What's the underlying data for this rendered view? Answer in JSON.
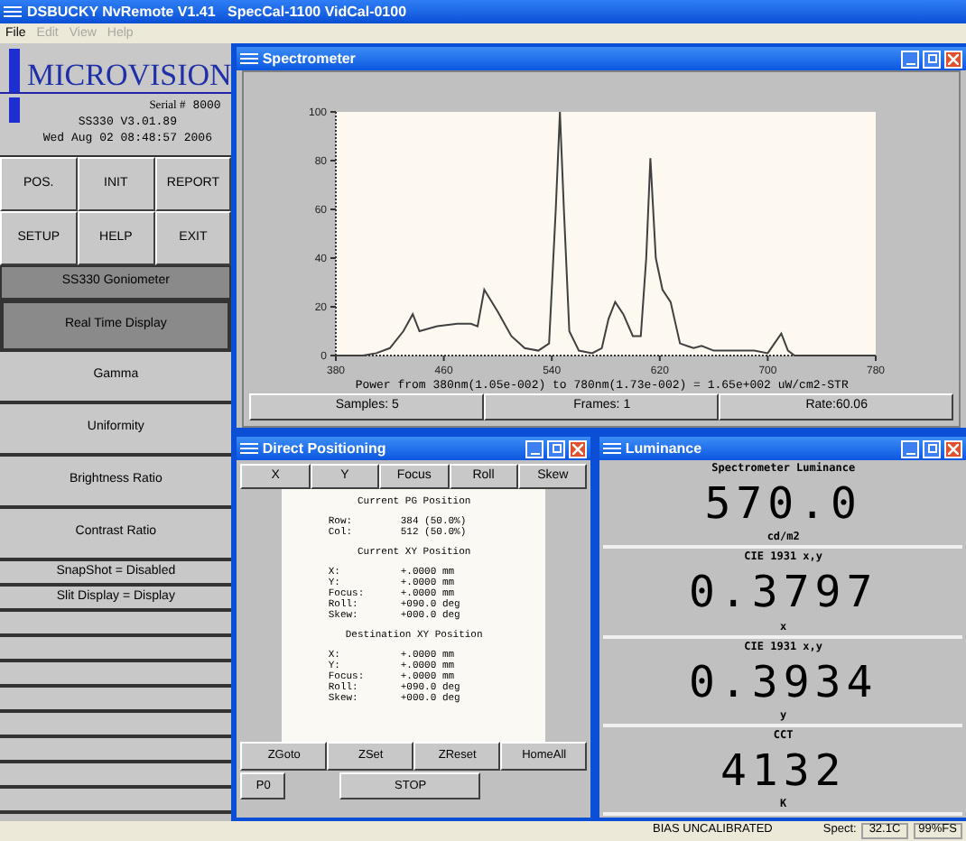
{
  "window": {
    "title": "DSBUCKY NvRemote V1.41   SpecCal-1100 VidCal-0100"
  },
  "menu": [
    {
      "label": "File",
      "disabled": false
    },
    {
      "label": "Edit",
      "disabled": true
    },
    {
      "label": "View",
      "disabled": true
    },
    {
      "label": "Help",
      "disabled": true
    }
  ],
  "sidebar": {
    "logo": "MICROVISION",
    "serial_label": "Serial #",
    "serial": "8000",
    "version": "SS330 V3.01.89",
    "datetime": "Wed Aug 02 08:48:57 2006",
    "buttons": [
      "POS.",
      "INIT",
      "REPORT",
      "SETUP",
      "HELP",
      "EXIT"
    ],
    "header": "SS330 Goniometer",
    "items": [
      {
        "label": "Real Time Display",
        "kind": "mode",
        "selected": true
      },
      {
        "label": "Gamma",
        "kind": "mode",
        "selected": false
      },
      {
        "label": "Uniformity",
        "kind": "mode",
        "selected": false
      },
      {
        "label": "Brightness Ratio",
        "kind": "mode",
        "selected": false
      },
      {
        "label": "Contrast Ratio",
        "kind": "mode",
        "selected": false
      },
      {
        "label": "SnapShot = Disabled",
        "kind": "setting",
        "selected": false
      },
      {
        "label": "Slit Display = Display",
        "kind": "setting",
        "selected": false
      }
    ]
  },
  "spectrometer": {
    "title": "Spectrometer",
    "chart_data": {
      "type": "line",
      "x": [
        380,
        400,
        410,
        420,
        430,
        437,
        442,
        455,
        470,
        480,
        485,
        490,
        500,
        510,
        520,
        530,
        538,
        543,
        546,
        549,
        553,
        560,
        570,
        577,
        582,
        587,
        593,
        600,
        606,
        610,
        613,
        617,
        622,
        628,
        635,
        645,
        651,
        660,
        690,
        700,
        705,
        710,
        715,
        720,
        780
      ],
      "series": [
        {
          "color": "#404040",
          "values": [
            0,
            0,
            1,
            3,
            10,
            17,
            10,
            12,
            13,
            13,
            12,
            27,
            18,
            8,
            3,
            2,
            5,
            60,
            100,
            60,
            10,
            2,
            1,
            3,
            15,
            22,
            17,
            8,
            8,
            40,
            81,
            40,
            27,
            22,
            5,
            3,
            4,
            2,
            2,
            1,
            5,
            9,
            2,
            0,
            0
          ]
        }
      ],
      "xlim": [
        380,
        780
      ],
      "ylim": [
        0,
        100
      ],
      "xticks": [
        380,
        460,
        540,
        620,
        700,
        780
      ],
      "yticks": [
        0,
        20,
        40,
        60,
        80,
        100
      ]
    },
    "power": "Power from 380nm(1.05e-002) to 780nm(1.73e-002) = 1.65e+002 uW/cm2-STR",
    "stats": [
      "Samples: 5",
      "Frames: 1",
      "Rate:60.06"
    ]
  },
  "direct_positioning": {
    "title": "Direct Positioning",
    "axis_buttons": [
      "X",
      "Y",
      "Focus",
      "Roll",
      "Skew"
    ],
    "sections": [
      {
        "title": "Current PG Position",
        "rows": [
          {
            "label": "Row:",
            "value": "384 (50.0%)"
          },
          {
            "label": "Col:",
            "value": "512 (50.0%)"
          }
        ]
      },
      {
        "title": "Current XY Position",
        "rows": [
          {
            "label": "X:",
            "value": "+.0000 mm"
          },
          {
            "label": "Y:",
            "value": "+.0000 mm"
          },
          {
            "label": "Focus:",
            "value": "+.0000 mm"
          },
          {
            "label": "Roll:",
            "value": "+090.0 deg"
          },
          {
            "label": "Skew:",
            "value": "+000.0 deg"
          }
        ]
      },
      {
        "title": "Destination XY Position",
        "rows": [
          {
            "label": "X:",
            "value": "+.0000 mm"
          },
          {
            "label": "Y:",
            "value": "+.0000 mm"
          },
          {
            "label": "Focus:",
            "value": "+.0000 mm"
          },
          {
            "label": "Roll:",
            "value": "+090.0 deg"
          },
          {
            "label": "Skew:",
            "value": "+000.0 deg"
          }
        ]
      }
    ],
    "buttons": [
      "ZGoto",
      "ZSet",
      "ZReset",
      "HomeAll"
    ],
    "p0": "P0",
    "stop": "STOP"
  },
  "luminance": {
    "title": "Luminance",
    "readouts": [
      {
        "title": "Spectrometer Luminance",
        "value": "570.0",
        "unit": "cd/m2"
      },
      {
        "title": "CIE 1931 x,y",
        "value": "0.3797",
        "unit": "x"
      },
      {
        "title": "CIE 1931 x,y",
        "value": "0.3934",
        "unit": "y"
      },
      {
        "title": "CCT",
        "value": "4132",
        "unit": "K"
      }
    ]
  },
  "status_bar": {
    "calibration": "BIAS UNCALIBRATED",
    "spect_label": "Spect:",
    "temperature": "32.1C",
    "range": "99%FS"
  }
}
